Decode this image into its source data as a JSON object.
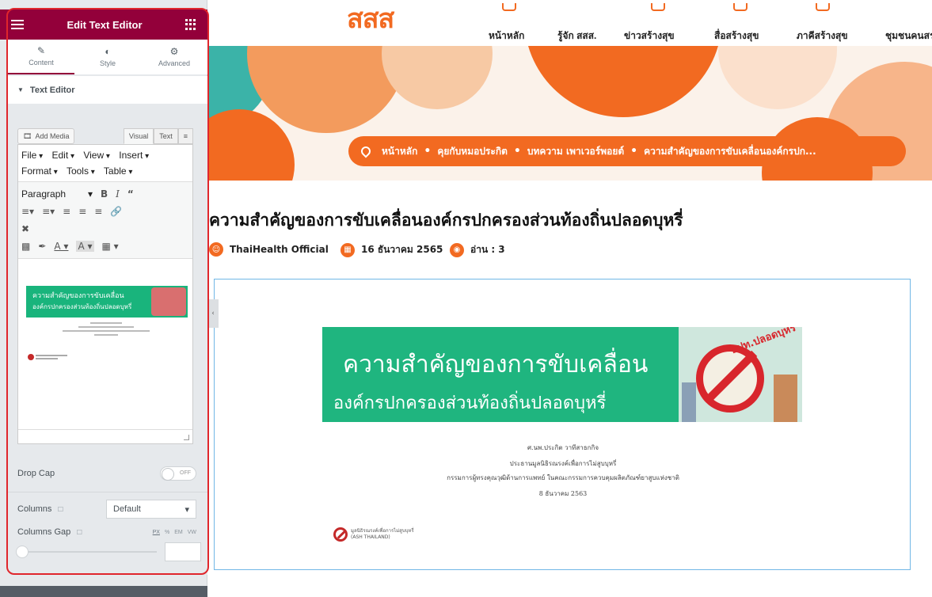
{
  "editor": {
    "title": "Edit Text Editor",
    "tabs": [
      {
        "label": "Content",
        "icon": "pencil-icon"
      },
      {
        "label": "Style",
        "icon": "half-circle-icon"
      },
      {
        "label": "Advanced",
        "icon": "gear-icon"
      }
    ],
    "section_title": "Text Editor",
    "add_media_label": "Add Media",
    "mode_visual": "Visual",
    "mode_text": "Text",
    "menus_row1": [
      "File",
      "Edit",
      "View",
      "Insert"
    ],
    "menus_row2": [
      "Format",
      "Tools",
      "Table"
    ],
    "paragraph_format": "Paragraph",
    "preview_banner_line1": "ความสำคัญของการขับเคลื่อน",
    "preview_banner_line2": "องค์กรปกครองส่วนท้องถิ่นปลอดบุหรี่",
    "drop_cap_label": "Drop Cap",
    "drop_cap_state": "OFF",
    "columns_label": "Columns",
    "columns_value": "Default",
    "columns_gap_label": "Columns Gap",
    "units": [
      "PX",
      "%",
      "EM",
      "VW"
    ]
  },
  "site": {
    "logo": "สสส",
    "nav": [
      "หน้าหลัก",
      "รู้จัก สสส.",
      "ข่าวสร้างสุข",
      "สื่อสร้างสุข",
      "ภาคีสร้างสุข",
      "ชุมชนคนสร"
    ],
    "breadcrumb": [
      "หน้าหลัก",
      "คุยกับหมอประกิต",
      "บทความ เพาเวอร์พอยต์",
      "ความสำคัญของการขับเคลื่อนองค์กรปก..."
    ],
    "title": "ความสำคัญของการขับเคลื่อนองค์กรปกครองส่วนท้องถิ่นปลอดบุหรี่",
    "author": "ThaiHealth Official",
    "date": "16 ธันวาคม 2565",
    "reads": "อ่าน : 3"
  },
  "content": {
    "banner_line1": "ความสำคัญของการขับเคลื่อน",
    "banner_line2": "องค์กรปกครองส่วนท้องถิ่นปลอดบุหรี่",
    "banner_tag": "อปท.ปลอดบุหรี่",
    "sub_line1": "ศ.นพ.ประกิต วาทีสาธกกิจ",
    "sub_line2": "ประธานมูลนิธิรณรงค์เพื่อการไม่สูบบุหรี่",
    "sub_line3": "กรรมการผู้ทรงคุณวุฒิด้านการแพทย์ ในคณะกรรมการควบคุมผลิตภัณฑ์ยาสูบแห่งชาติ",
    "sub_line4": "8 ธันวาคม 2563",
    "ash_line1": "มูลนิธิรณรงค์เพื่อการไม่สูบบุหรี่",
    "ash_line2": "(ASH THAILAND)"
  },
  "colors": {
    "editor_header": "#93003a",
    "accent_orange": "#f26a21",
    "banner_green": "#1fb57f",
    "highlight_frame": "#e0262c"
  }
}
